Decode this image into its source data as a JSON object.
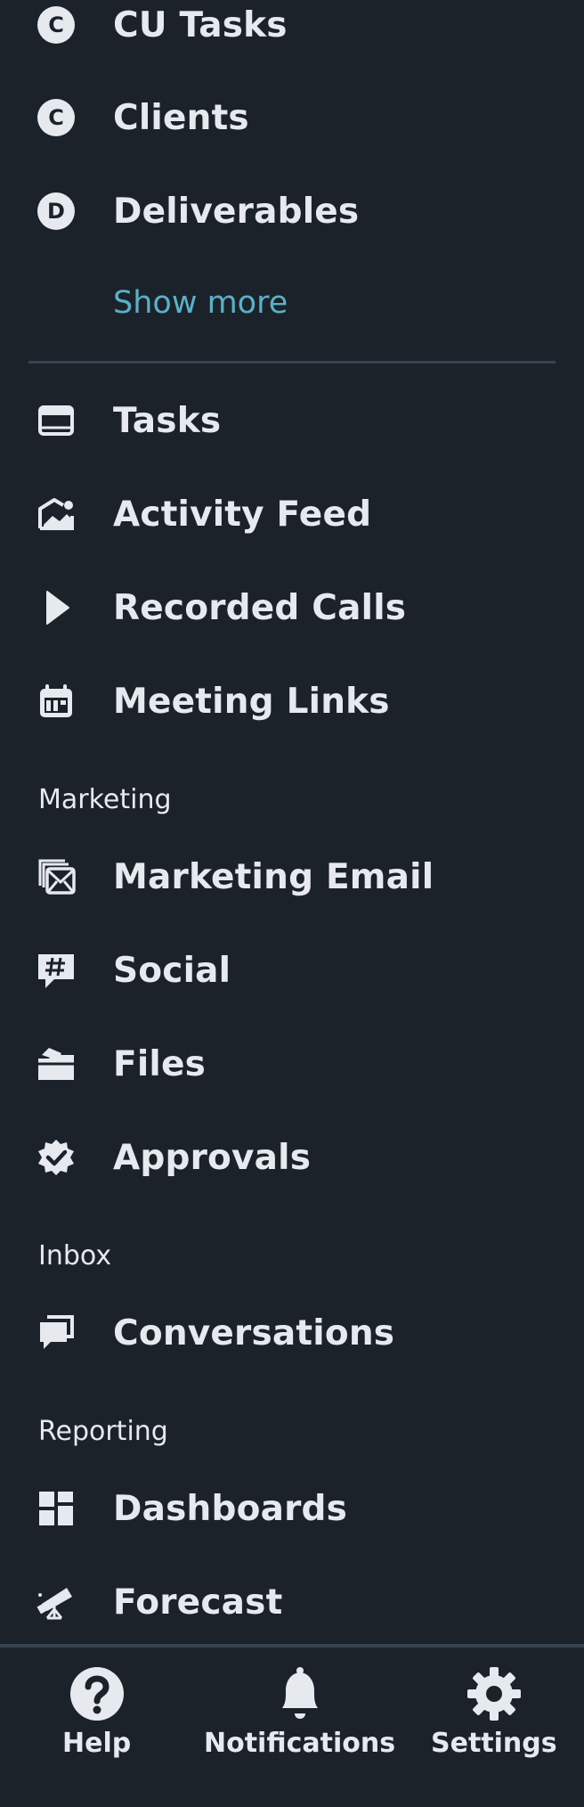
{
  "menu": {
    "items": [
      {
        "label": "CU Tasks",
        "icon": "letter-c-badge",
        "badge": "C"
      },
      {
        "label": "Clients",
        "icon": "letter-c-badge",
        "badge": "C"
      },
      {
        "label": "Deliverables",
        "icon": "letter-d-badge",
        "badge": "D"
      }
    ],
    "show_more": "Show more",
    "tools": [
      {
        "label": "Tasks",
        "icon": "tasks-icon"
      },
      {
        "label": "Activity Feed",
        "icon": "activity-feed-icon"
      },
      {
        "label": "Recorded Calls",
        "icon": "play-icon"
      },
      {
        "label": "Meeting Links",
        "icon": "calendar-icon"
      }
    ],
    "sections": {
      "marketing": {
        "title": "Marketing",
        "items": [
          {
            "label": "Marketing Email",
            "icon": "marketing-email-icon"
          },
          {
            "label": "Social",
            "icon": "social-hashtag-icon"
          },
          {
            "label": "Files",
            "icon": "folder-icon"
          },
          {
            "label": "Approvals",
            "icon": "approval-badge-icon"
          }
        ]
      },
      "inbox": {
        "title": "Inbox",
        "items": [
          {
            "label": "Conversations",
            "icon": "conversations-icon"
          }
        ]
      },
      "reporting": {
        "title": "Reporting",
        "items": [
          {
            "label": "Dashboards",
            "icon": "dashboard-icon"
          },
          {
            "label": "Forecast",
            "icon": "telescope-icon"
          }
        ]
      }
    }
  },
  "bottom_nav": {
    "help": "Help",
    "notifications": "Notifications",
    "settings": "Settings"
  },
  "colors": {
    "background": "#1c222a",
    "text": "#e6e9ee",
    "link": "#5ab1c7",
    "divider": "#364350"
  }
}
